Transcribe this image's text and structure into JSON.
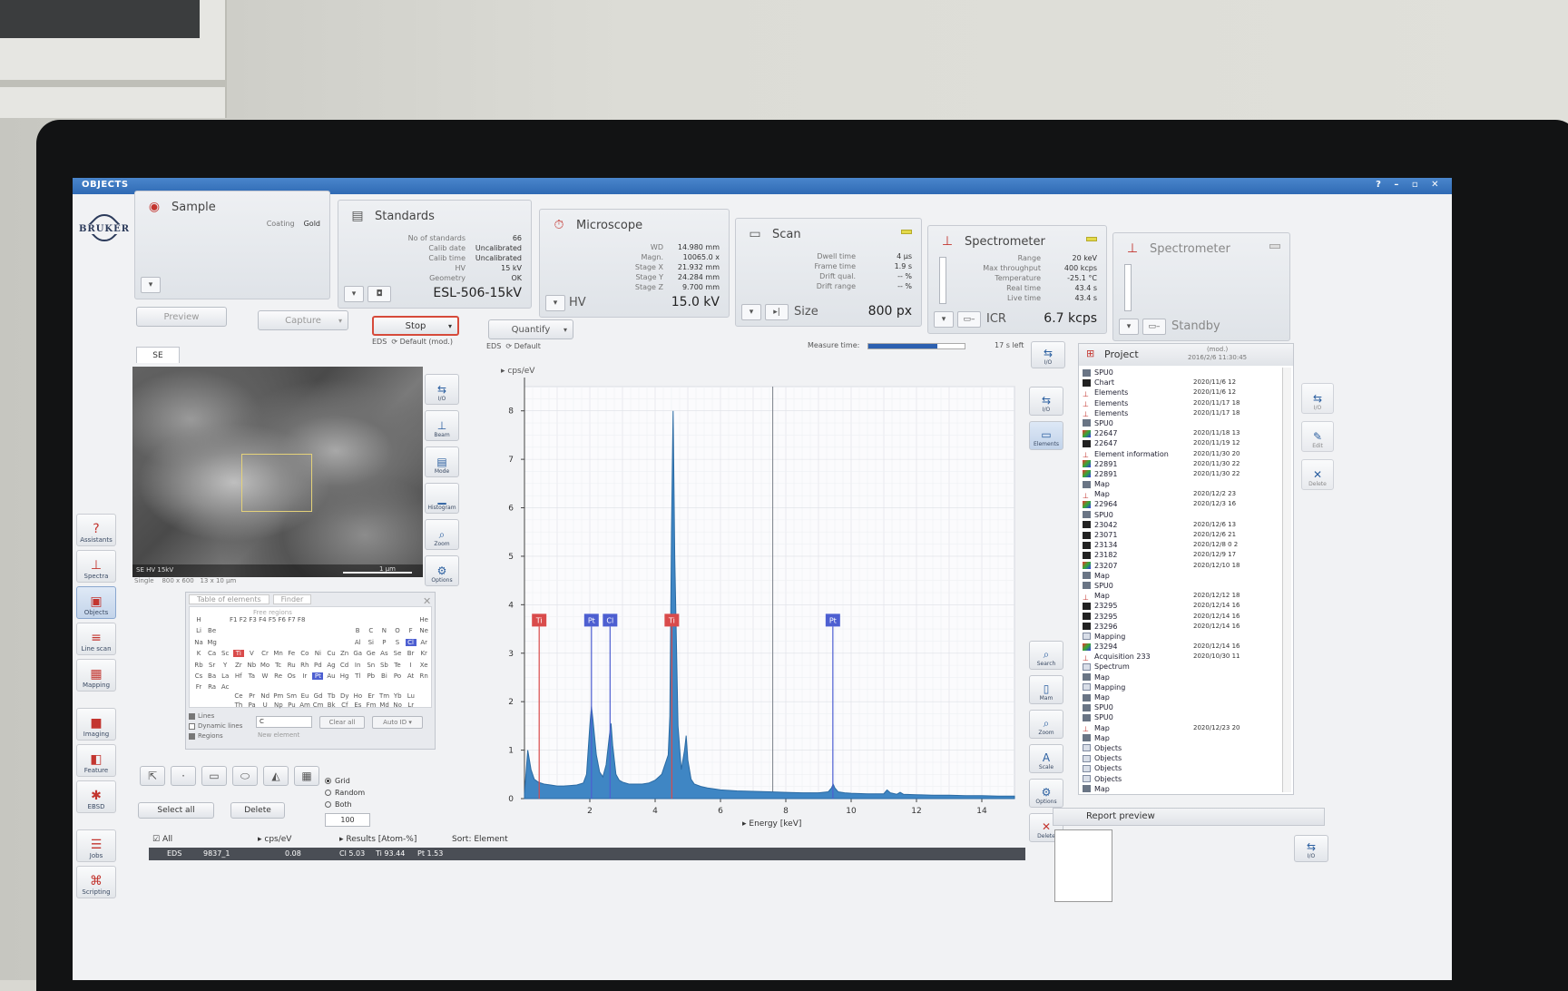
{
  "window": {
    "title": "OBJECTS",
    "controls": [
      "?",
      "–",
      "▫",
      "✕"
    ]
  },
  "logo": {
    "text": "BRUKER"
  },
  "left_tools": [
    {
      "label": "Assistants",
      "glyph": "?"
    },
    {
      "label": "Spectra",
      "glyph": "⊥"
    },
    {
      "label": "Objects",
      "glyph": "▣"
    },
    {
      "label": "Line scan",
      "glyph": "≡"
    },
    {
      "label": "Mapping",
      "glyph": "▦"
    },
    {
      "label": "Imaging",
      "glyph": "■"
    },
    {
      "label": "Feature",
      "glyph": "◧"
    },
    {
      "label": "EBSD",
      "glyph": "✱"
    },
    {
      "label": "Jobs",
      "glyph": "☰"
    },
    {
      "label": "Scripting",
      "glyph": "⌘"
    }
  ],
  "panels": {
    "sample": {
      "title": "Sample",
      "coating_label": "Coating",
      "coating_value": "Gold"
    },
    "standards": {
      "title": "Standards",
      "rows": [
        {
          "k": "No of standards",
          "v": "66"
        },
        {
          "k": "Calib date",
          "v": "Uncalibrated"
        },
        {
          "k": "Calib time",
          "v": "Uncalibrated"
        },
        {
          "k": "HV",
          "v": "15 kV"
        },
        {
          "k": "Geometry",
          "v": "OK"
        }
      ],
      "big": "ESL-506-15kV"
    },
    "microscope": {
      "title": "Microscope",
      "rows": [
        {
          "k": "WD",
          "v": "14.980 mm"
        },
        {
          "k": "Magn.",
          "v": "10065.0 x"
        },
        {
          "k": "Stage X",
          "v": "21.932 mm"
        },
        {
          "k": "Stage Y",
          "v": "24.284 mm"
        },
        {
          "k": "Stage Z",
          "v": "9.700 mm"
        }
      ],
      "label": "HV",
      "big": "15.0 kV"
    },
    "scan": {
      "title": "Scan",
      "rows": [
        {
          "k": "Dwell time",
          "v": "4 µs"
        },
        {
          "k": "Frame time",
          "v": "1.9 s"
        },
        {
          "k": "Drift qual.",
          "v": "-- %"
        },
        {
          "k": "Drift range",
          "v": "-- %"
        }
      ],
      "label": "Size",
      "big": "800 px"
    },
    "spectrometer": {
      "title": "Spectrometer",
      "rows": [
        {
          "k": "Range",
          "v": "20 keV"
        },
        {
          "k": "Max throughput",
          "v": "400 kcps"
        },
        {
          "k": "Temperature",
          "v": "-25.1 °C"
        },
        {
          "k": "Real time",
          "v": "43.4 s"
        },
        {
          "k": "Live time",
          "v": "43.4 s"
        }
      ],
      "label": "ICR",
      "big": "6.7 kcps"
    },
    "spectrometer2": {
      "title": "Spectrometer",
      "label": "Standby"
    }
  },
  "actions": {
    "preview": "Preview",
    "capture": "Capture",
    "stop": "Stop",
    "quantify": "Quantify",
    "eds1": "EDS",
    "default_mod": "Default (mod.)",
    "eds2": "EDS",
    "default": "Default",
    "measure_label": "Measure time:",
    "measure_progress": 0.72,
    "time_left": "17 s left"
  },
  "image": {
    "tab": "SE",
    "strip": "SE  HV  15kV",
    "scale": "1 µm",
    "mode": "Single",
    "size": "800 x 600",
    "field": "13 x 10 µm"
  },
  "image_tools": [
    {
      "label": "I/O",
      "glyph": "⇆"
    },
    {
      "label": "Beam",
      "glyph": "⊥"
    },
    {
      "label": "Mode",
      "glyph": "▤"
    },
    {
      "label": "Histogram",
      "glyph": "▁"
    },
    {
      "label": "Zoom",
      "glyph": "⌕"
    },
    {
      "label": "Options",
      "glyph": "⚙"
    }
  ],
  "periodic": {
    "tabs": [
      "Table of elements",
      "Finder"
    ],
    "free_regions": "Free regions",
    "fkeys": "F1 F2 F3 F4 F5 F6 F7 F8",
    "lines_label": "Lines",
    "dynamic_label": "Dynamic lines",
    "regions_label": "Regions",
    "input_value": "C",
    "clear_all": "Clear all",
    "auto_id": "Auto ID",
    "new_element": "New element",
    "elements": [
      [
        "H",
        "",
        "",
        "",
        "",
        "",
        "",
        "",
        "",
        "",
        "",
        "",
        "",
        "",
        "",
        "",
        "",
        "He"
      ],
      [
        "Li",
        "Be",
        "",
        "",
        "",
        "",
        "",
        "",
        "",
        "",
        "",
        "",
        "B",
        "C",
        "N",
        "O",
        "F",
        "Ne"
      ],
      [
        "Na",
        "Mg",
        "",
        "",
        "",
        "",
        "",
        "",
        "",
        "",
        "",
        "",
        "Al",
        "Si",
        "P",
        "S",
        "Cl",
        "Ar"
      ],
      [
        "K",
        "Ca",
        "Sc",
        "Ti",
        "V",
        "Cr",
        "Mn",
        "Fe",
        "Co",
        "Ni",
        "Cu",
        "Zn",
        "Ga",
        "Ge",
        "As",
        "Se",
        "Br",
        "Kr"
      ],
      [
        "Rb",
        "Sr",
        "Y",
        "Zr",
        "Nb",
        "Mo",
        "Tc",
        "Ru",
        "Rh",
        "Pd",
        "Ag",
        "Cd",
        "In",
        "Sn",
        "Sb",
        "Te",
        "I",
        "Xe"
      ],
      [
        "Cs",
        "Ba",
        "La",
        "Hf",
        "Ta",
        "W",
        "Re",
        "Os",
        "Ir",
        "Pt",
        "Au",
        "Hg",
        "Tl",
        "Pb",
        "Bi",
        "Po",
        "At",
        "Rn"
      ],
      [
        "Fr",
        "Ra",
        "Ac",
        "",
        "",
        "",
        "",
        "",
        "",
        "",
        "",
        "",
        "",
        "",
        "",
        "",
        "",
        ""
      ]
    ],
    "lanthanides": [
      "Ce",
      "Pr",
      "Nd",
      "Pm",
      "Sm",
      "Eu",
      "Gd",
      "Tb",
      "Dy",
      "Ho",
      "Er",
      "Tm",
      "Yb",
      "Lu"
    ],
    "actinides": [
      "Th",
      "Pa",
      "U",
      "Np",
      "Pu",
      "Am",
      "Cm",
      "Bk",
      "Cf",
      "Es",
      "Fm",
      "Md",
      "No",
      "Lr"
    ],
    "red": [
      "Ti"
    ],
    "blue": [
      "Cl",
      "Pt"
    ]
  },
  "shape_tools": [
    {
      "name": "select-pointer",
      "glyph": "⇱"
    },
    {
      "name": "point",
      "glyph": "·"
    },
    {
      "name": "rectangle",
      "glyph": "▭"
    },
    {
      "name": "ellipse",
      "glyph": "⬭"
    },
    {
      "name": "polygon",
      "glyph": "◭"
    },
    {
      "name": "grid",
      "glyph": "▦"
    }
  ],
  "grid_options": [
    "Grid",
    "Random",
    "Both"
  ],
  "grid_value": "100",
  "select_all": "Select all",
  "delete": "Delete",
  "chart_tools": [
    {
      "label": "I/O",
      "glyph": "⇆"
    },
    {
      "label": "Elements",
      "glyph": "▭"
    }
  ],
  "chart_tools_lower": [
    {
      "label": "Search",
      "glyph": "⌕"
    },
    {
      "label": "Mam",
      "glyph": "▯"
    },
    {
      "label": "Zoom",
      "glyph": "⌕"
    },
    {
      "label": "Scale",
      "glyph": "A"
    },
    {
      "label": "Options",
      "glyph": "⚙"
    },
    {
      "label": "Delete",
      "glyph": "✕"
    }
  ],
  "chart_data": {
    "type": "line",
    "ylabel": "cps/eV",
    "xlabel": "Energy [keV]",
    "xlim": [
      0,
      15
    ],
    "ylim": [
      0,
      8.5
    ],
    "xticks": [
      2,
      4,
      6,
      8,
      10,
      12,
      14
    ],
    "yticks": [
      0,
      1,
      2,
      3,
      4,
      5,
      6,
      7,
      8
    ],
    "series": [
      {
        "x": [
          0.0,
          0.1,
          0.2,
          0.3,
          0.4,
          0.5,
          0.6,
          0.8,
          1.0,
          1.2,
          1.4,
          1.6,
          1.8,
          1.9,
          2.0,
          2.05,
          2.1,
          2.2,
          2.3,
          2.4,
          2.5,
          2.6,
          2.65,
          2.7,
          2.8,
          2.9,
          3.0,
          3.2,
          3.4,
          3.6,
          3.8,
          4.0,
          4.2,
          4.4,
          4.45,
          4.5,
          4.55,
          4.6,
          4.7,
          4.8,
          4.9,
          4.95,
          5.0,
          5.1,
          5.2,
          5.4,
          5.6,
          5.8,
          6.0,
          6.5,
          7.0,
          7.5,
          8.0,
          8.5,
          9.0,
          9.3,
          9.4,
          9.45,
          9.5,
          9.6,
          9.8,
          10.0,
          10.5,
          11.0,
          11.05,
          11.1,
          11.2,
          11.4,
          11.5,
          11.6,
          12.0,
          12.5,
          13.0,
          13.5,
          14.0,
          14.5,
          15.0
        ],
        "y": [
          0.1,
          1.0,
          0.6,
          0.4,
          0.35,
          0.32,
          0.3,
          0.28,
          0.26,
          0.26,
          0.27,
          0.28,
          0.32,
          0.5,
          1.5,
          1.9,
          1.6,
          0.9,
          0.55,
          0.45,
          0.7,
          1.3,
          1.55,
          1.1,
          0.5,
          0.38,
          0.34,
          0.3,
          0.3,
          0.3,
          0.32,
          0.38,
          0.5,
          0.9,
          1.7,
          5.5,
          8.0,
          5.0,
          1.5,
          0.6,
          1.0,
          1.3,
          0.8,
          0.4,
          0.3,
          0.25,
          0.22,
          0.2,
          0.18,
          0.16,
          0.15,
          0.14,
          0.13,
          0.12,
          0.12,
          0.14,
          0.22,
          0.3,
          0.22,
          0.14,
          0.12,
          0.11,
          0.1,
          0.1,
          0.14,
          0.18,
          0.12,
          0.09,
          0.13,
          0.09,
          0.08,
          0.07,
          0.07,
          0.06,
          0.06,
          0.05,
          0.05
        ]
      }
    ],
    "markers": [
      {
        "label": "Ti",
        "x": 0.45,
        "color": "#d94b4b"
      },
      {
        "label": "Pt",
        "x": 2.05,
        "color": "#4d5fd1"
      },
      {
        "label": "Cl",
        "x": 2.62,
        "color": "#4d5fd1"
      },
      {
        "label": "Ti",
        "x": 4.51,
        "color": "#d94b4b"
      },
      {
        "label": "Pt",
        "x": 9.44,
        "color": "#4d5fd1"
      }
    ]
  },
  "project": {
    "title": "Project",
    "mod": "(mod.)",
    "date": "2016/2/6 11:30:45",
    "items": [
      {
        "icon": "grey",
        "name": "SPU0",
        "date": ""
      },
      {
        "icon": "dark",
        "name": "Chart",
        "date": "2020/11/6   12"
      },
      {
        "icon": "red",
        "name": "Elements",
        "date": "2020/11/6   12"
      },
      {
        "icon": "red",
        "name": "Elements",
        "date": "2020/11/17  18"
      },
      {
        "icon": "red",
        "name": "Elements",
        "date": "2020/11/17  18"
      },
      {
        "icon": "grey",
        "name": "SPU0",
        "date": ""
      },
      {
        "icon": "img",
        "name": "22647",
        "date": "2020/11/18  13"
      },
      {
        "icon": "dark",
        "name": "22647",
        "date": "2020/11/19  12"
      },
      {
        "icon": "red",
        "name": "Element information",
        "date": "2020/11/30  20"
      },
      {
        "icon": "img",
        "name": "22891",
        "date": "2020/11/30  22"
      },
      {
        "icon": "img",
        "name": "22891",
        "date": "2020/11/30  22"
      },
      {
        "icon": "grey",
        "name": "Map",
        "date": ""
      },
      {
        "icon": "red",
        "name": "Map",
        "date": "2020/12/2   23"
      },
      {
        "icon": "img",
        "name": "22964",
        "date": "2020/12/3   16"
      },
      {
        "icon": "grey",
        "name": "SPU0",
        "date": ""
      },
      {
        "icon": "dark",
        "name": "23042",
        "date": "2020/12/6   13"
      },
      {
        "icon": "dark",
        "name": "23071",
        "date": "2020/12/6   21"
      },
      {
        "icon": "dark",
        "name": "23134",
        "date": "2020/12/8   0 2"
      },
      {
        "icon": "dark",
        "name": "23182",
        "date": "2020/12/9   17"
      },
      {
        "icon": "img",
        "name": "23207",
        "date": "2020/12/10  18"
      },
      {
        "icon": "grey",
        "name": "Map",
        "date": ""
      },
      {
        "icon": "grey",
        "name": "SPU0",
        "date": ""
      },
      {
        "icon": "red",
        "name": "Map",
        "date": "2020/12/12  18"
      },
      {
        "icon": "dark",
        "name": "23295",
        "date": "2020/12/14  16"
      },
      {
        "icon": "dark",
        "name": "23295",
        "date": "2020/12/14  16"
      },
      {
        "icon": "dark",
        "name": "23296",
        "date": "2020/12/14  16"
      },
      {
        "icon": "folder",
        "name": "Mapping",
        "date": ""
      },
      {
        "icon": "img",
        "name": "23294",
        "date": "2020/12/14  16"
      },
      {
        "icon": "red",
        "name": "Acquisition 233",
        "date": "2020/10/30  11"
      },
      {
        "icon": "folder",
        "name": "Spectrum",
        "date": ""
      },
      {
        "icon": "grey",
        "name": "Map",
        "date": ""
      },
      {
        "icon": "folder",
        "name": "Mapping",
        "date": ""
      },
      {
        "icon": "grey",
        "name": "Map",
        "date": ""
      },
      {
        "icon": "grey",
        "name": "SPU0",
        "date": ""
      },
      {
        "icon": "grey",
        "name": "SPU0",
        "date": ""
      },
      {
        "icon": "red",
        "name": "Map",
        "date": "2020/12/23  20"
      },
      {
        "icon": "grey",
        "name": "Map",
        "date": ""
      },
      {
        "icon": "folder",
        "name": "Objects",
        "date": ""
      },
      {
        "icon": "folder",
        "name": "Objects",
        "date": ""
      },
      {
        "icon": "folder",
        "name": "Objects",
        "date": ""
      },
      {
        "icon": "folder",
        "name": "Objects",
        "date": ""
      },
      {
        "icon": "grey",
        "name": "Map",
        "date": ""
      }
    ]
  },
  "project_tools": [
    {
      "label": "I/O",
      "glyph": "⇆"
    },
    {
      "label": "Edit",
      "glyph": "✎"
    },
    {
      "label": "Delete",
      "glyph": "✕"
    }
  ],
  "report": {
    "title": "Report preview",
    "io": "I/O"
  },
  "results": {
    "all": "All",
    "cps": "cps/eV",
    "results": "Results [Atom-%]",
    "sort": "Sort: Element",
    "row": {
      "type": "EDS",
      "name": "9837_1",
      "val": "0.08",
      "cl": "Cl 5.03",
      "ti": "Ti 93.44",
      "pt": "Pt 1.53"
    }
  }
}
